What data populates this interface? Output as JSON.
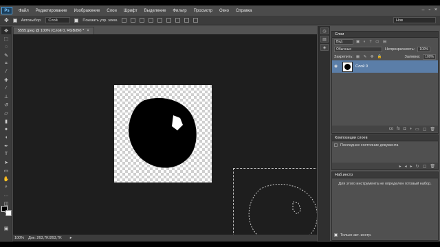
{
  "app": {
    "logo": "Ps"
  },
  "menu": [
    "Файл",
    "Редактирование",
    "Изображение",
    "Слои",
    "Шрифт",
    "Выделение",
    "Фильтр",
    "Просмотр",
    "Окно",
    "Справка"
  ],
  "window_controls": {
    "minimize": "–",
    "maximize": "▫",
    "close": "×"
  },
  "options": {
    "autoselect_label": "Автовыбор:",
    "autoselect_value": "Слой",
    "show_controls_label": "Показать упр. элем."
  },
  "workspace": {
    "value": "Нов"
  },
  "document": {
    "tab_title": "5555.jpeg @ 100% (Слой 0, RGB/8#) *",
    "tab_close": "×",
    "zoom": "100%",
    "doc_info": "Док: 263,7K/263,7K",
    "status_arrow": "▸"
  },
  "layers_panel": {
    "title": "Слои",
    "filter_label": "Вид",
    "blend_mode": "Обычные",
    "opacity_label": "Непрозрачность:",
    "opacity_value": "100%",
    "lock_label": "Закрепить:",
    "fill_label": "Заливка:",
    "fill_value": "100%",
    "layers": [
      {
        "name": "Слой 0",
        "selected": true
      }
    ],
    "footer_icons": [
      "co",
      "fx",
      "◘",
      "◑",
      "▭",
      "▢",
      "🗑"
    ]
  },
  "comps_panel": {
    "title": "Композиции слоев",
    "row_label": "Последнее состояние документа",
    "footer_icons": [
      "▸",
      "◂",
      "▸",
      "↻",
      "▢",
      "🗑"
    ]
  },
  "presets_panel": {
    "title": "Наб.инстр",
    "message": "Для этого инструмента не определен готовый набор.",
    "checkbox_label": "Только акт. инстр."
  },
  "colors": {
    "foreground": "#000000",
    "background": "#ffffff",
    "layer_selected": "#5b7ea8"
  }
}
